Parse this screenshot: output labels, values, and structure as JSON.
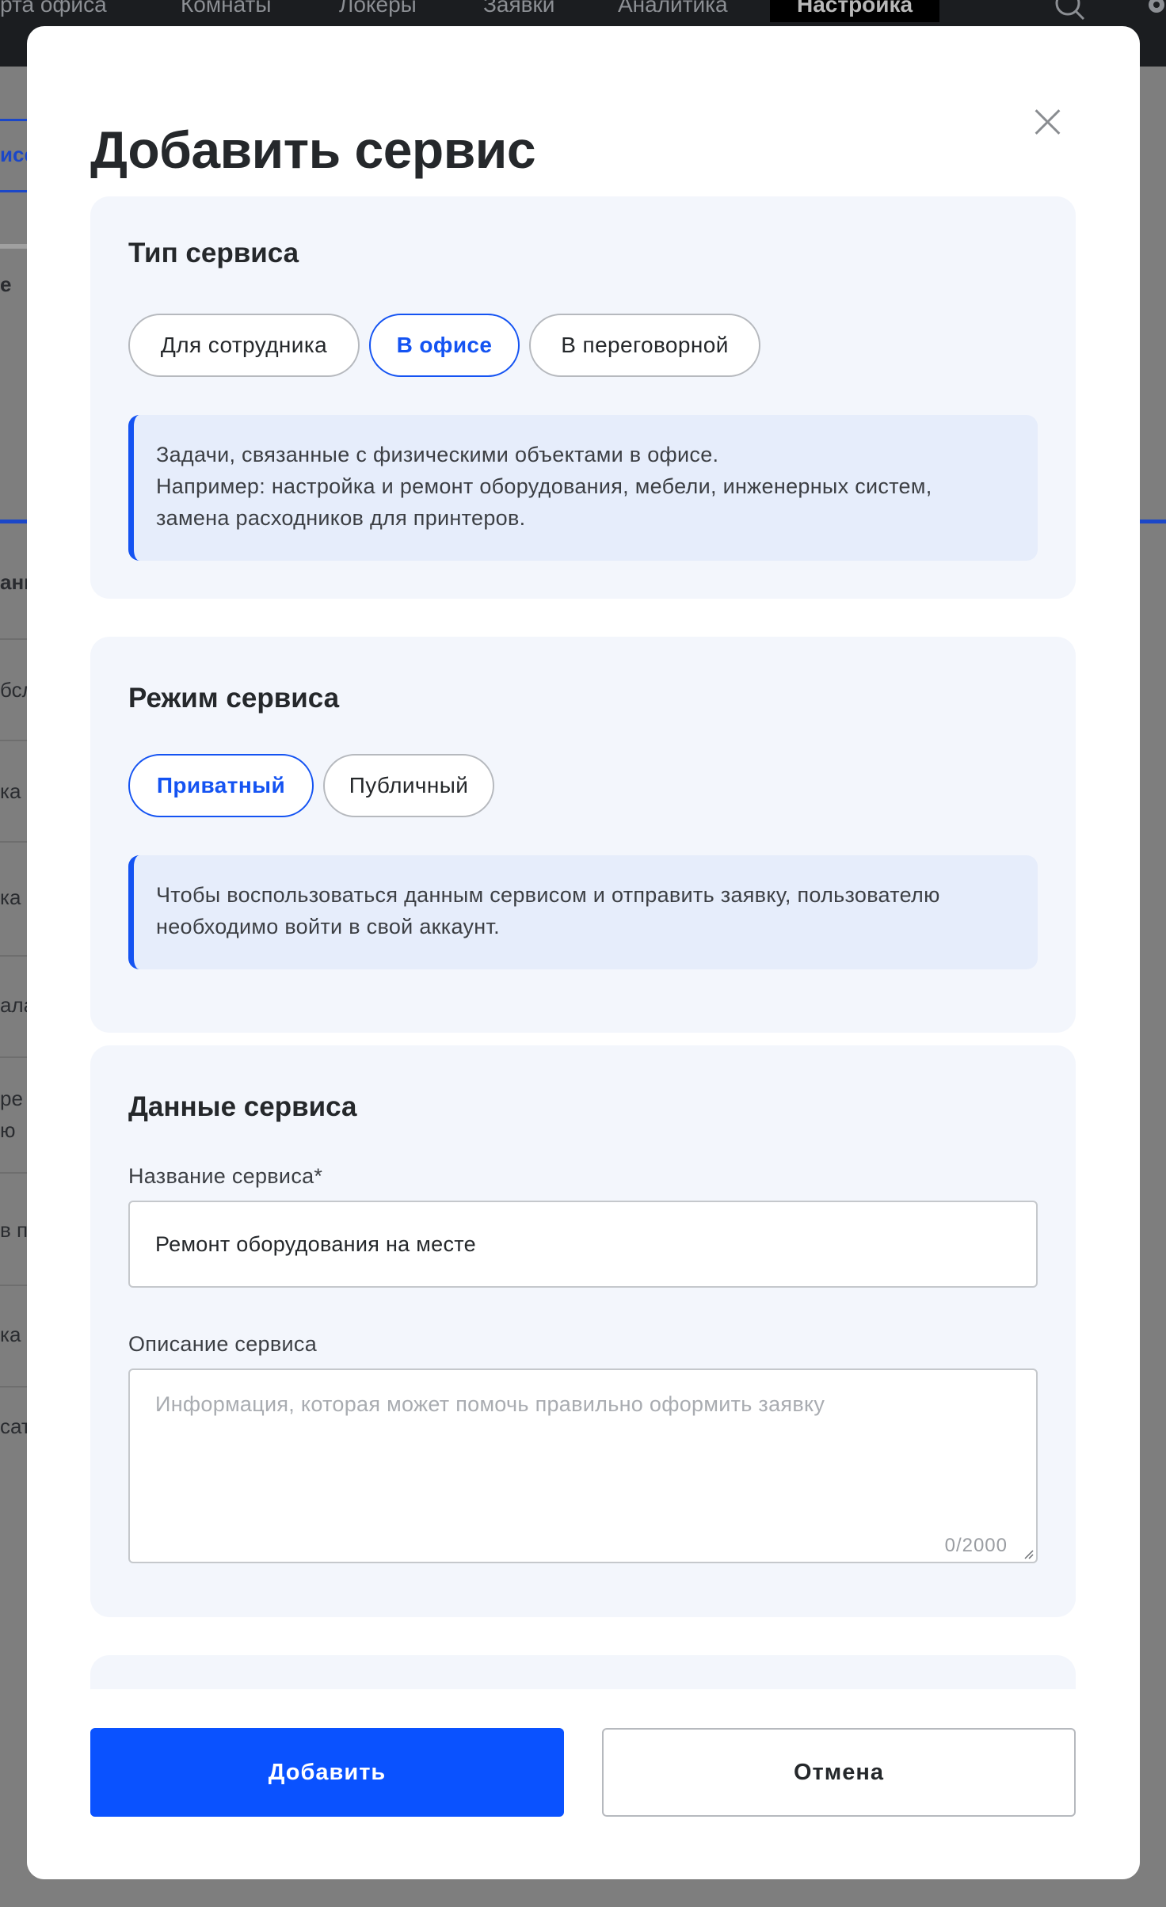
{
  "app": {
    "topnav": [
      {
        "label": "рта офиса"
      },
      {
        "label": "Комнаты"
      },
      {
        "label": "Локеры"
      },
      {
        "label": "Заявки"
      },
      {
        "label": "Аналитика"
      },
      {
        "label": "Настройка",
        "active": true
      }
    ],
    "icons": [
      "search-icon",
      "settings-icon"
    ],
    "sidebar_fragments": [
      "исе",
      "е",
      "анн",
      "бсл",
      "ка н",
      "ка н",
      "ала",
      "ре",
      "ю",
      "в п",
      "ка",
      "сат"
    ]
  },
  "modal": {
    "title": "Добавить сервис",
    "close_icon": "close-icon",
    "service_type": {
      "title": "Тип сервиса",
      "options": [
        "Для сотрудника",
        "В офисе",
        "В переговорной"
      ],
      "selected": "В офисе",
      "info_lines": [
        "Задачи, связанные с физическими объектами в офисе.",
        "Например: настройка и ремонт оборудования, мебели, инженерных систем,",
        "замена расходников для принтеров."
      ]
    },
    "service_mode": {
      "title": "Режим сервиса",
      "options": [
        "Приватный",
        "Публичный"
      ],
      "selected": "Приватный",
      "info_lines": [
        "Чтобы воспользоваться данным сервисом и отправить заявку, пользователю",
        "необходимо войти в свой аккаунт."
      ]
    },
    "service_data": {
      "title": "Данные сервиса",
      "name_label": "Название сервиса*",
      "name_value": "Ремонт оборудования на месте",
      "description_label": "Описание сервиса",
      "description_placeholder": "Информация, которая может помочь правильно оформить заявку",
      "description_value": "",
      "counter": "0/2000"
    },
    "buttons": {
      "submit": "Добавить",
      "cancel": "Отмена"
    },
    "colors": {
      "accent": "#0a52ff",
      "info_bg": "#e6edfb",
      "card_bg": "#f3f6fc"
    }
  }
}
